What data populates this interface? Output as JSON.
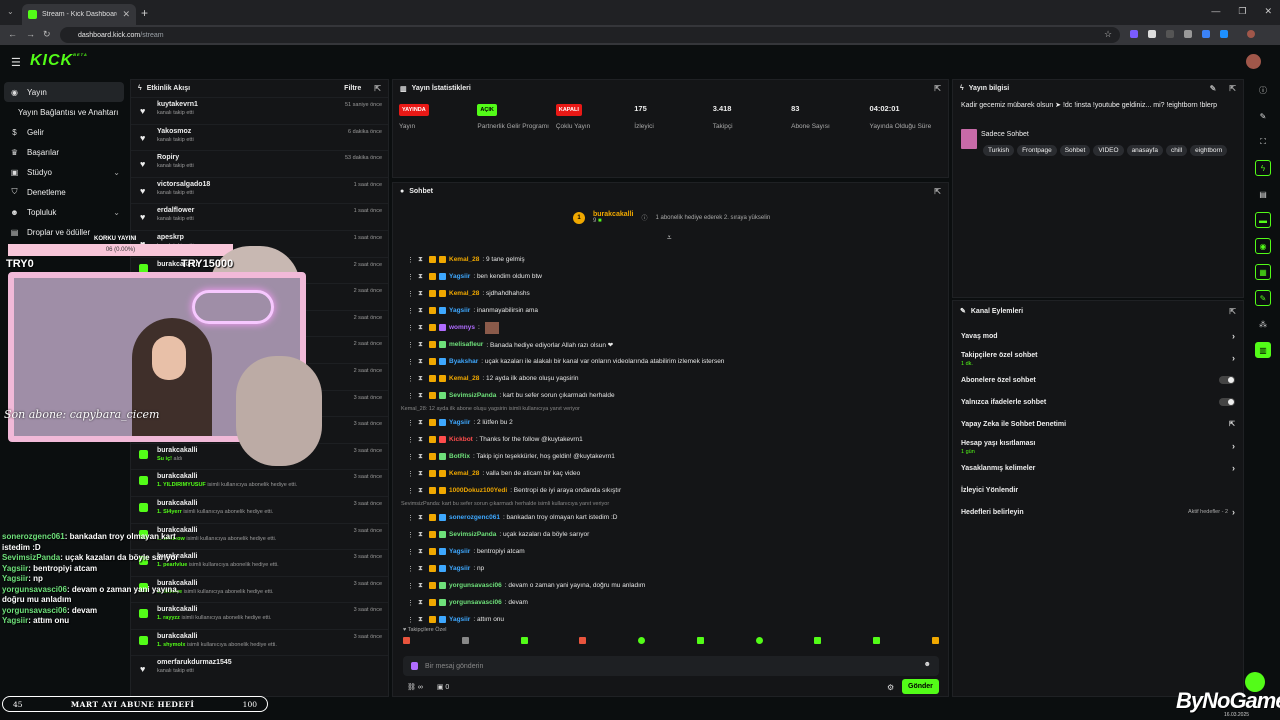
{
  "browser": {
    "tab_title": "Stream - Kick Dashboard",
    "url_host": "dashboard.kick.com",
    "url_path": "/stream"
  },
  "brand": {
    "logo": "KICK",
    "logo_sup": "BETA",
    "accent": "#53fc18"
  },
  "sidebar": {
    "items": [
      {
        "label": "Yayın",
        "icon": "broadcast-icon"
      },
      {
        "label": "Yayın Bağlantısı ve Anahtarı",
        "icon": "key-icon"
      },
      {
        "label": "Gelir",
        "icon": "money-icon"
      },
      {
        "label": "Başarılar",
        "icon": "trophy-icon"
      },
      {
        "label": "Stüdyo",
        "icon": "studio-icon"
      },
      {
        "label": "Denetleme",
        "icon": "shield-icon"
      },
      {
        "label": "Topluluk",
        "icon": "community-icon"
      },
      {
        "label": "Droplar ve ödüller",
        "icon": "gift-icon"
      }
    ]
  },
  "activity": {
    "title": "Etkinlik Akışı",
    "filter": "Filtre",
    "rows": [
      {
        "name": "kuytakevrn1",
        "desc": "kanalı takip etti",
        "time": "51 saniye önce",
        "kind": "follow"
      },
      {
        "name": "Yakosmoz",
        "desc": "kanalı takip etti",
        "time": "6 dakika önce",
        "kind": "follow"
      },
      {
        "name": "Ropiry",
        "desc": "kanalı takip etti",
        "time": "53 dakika önce",
        "kind": "follow"
      },
      {
        "name": "victorsalgado18",
        "desc": "kanalı takip etti",
        "time": "1 saat önce",
        "kind": "follow"
      },
      {
        "name": "erdalflower",
        "desc": "kanalı takip etti",
        "time": "1 saat önce",
        "kind": "follow"
      },
      {
        "name": "apeskrp",
        "desc": "kanalı takip etti",
        "time": "1 saat önce",
        "kind": "follow"
      },
      {
        "name": "burakcakalli",
        "desc": "",
        "time": "2 saat önce",
        "kind": "gift"
      },
      {
        "name": "",
        "desc": "",
        "time": "2 saat önce",
        "kind": "gift"
      },
      {
        "name": "",
        "desc": "",
        "time": "2 saat önce",
        "kind": "gift"
      },
      {
        "name": "",
        "desc": "",
        "time": "2 saat önce",
        "kind": "gift"
      },
      {
        "name": "",
        "desc": "",
        "time": "2 saat önce",
        "kind": "gift"
      },
      {
        "name": "",
        "desc": "",
        "time": "3 saat önce",
        "kind": "gift"
      },
      {
        "name": "",
        "desc": "",
        "time": "3 saat önce",
        "kind": "gift"
      },
      {
        "name": "burakcakalli",
        "desc_b": "Su iç!",
        "desc": "aldı",
        "time": "3 saat önce",
        "kind": "gift"
      },
      {
        "name": "burakcakalli",
        "desc_b": "1. YILDIRIMYUSUF",
        "desc": "isimli kullanıcıya abonelik hediye etti.",
        "time": "3 saat önce",
        "kind": "gift"
      },
      {
        "name": "burakcakalli",
        "desc_b": "1. Sl4yerr",
        "desc": "isimli kullanıcıya abonelik hediye etti.",
        "time": "3 saat önce",
        "kind": "gift"
      },
      {
        "name": "burakcakalli",
        "desc_b": "1. whusow",
        "desc": "isimli kullanıcıya abonelik hediye etti.",
        "time": "3 saat önce",
        "kind": "gift"
      },
      {
        "name": "burakcakalli",
        "desc_b": "1. pearlvlue",
        "desc": "isimli kullanıcıya abonelik hediye etti.",
        "time": "3 saat önce",
        "kind": "gift"
      },
      {
        "name": "burakcakalli",
        "desc_b": "1. W3xlee",
        "desc": "isimli kullanıcıya abonelik hediye etti.",
        "time": "3 saat önce",
        "kind": "gift"
      },
      {
        "name": "burakcakalli",
        "desc_b": "1. rayyzz",
        "desc": "isimli kullanıcıya abonelik hediye etti.",
        "time": "3 saat önce",
        "kind": "gift"
      },
      {
        "name": "burakcakalli",
        "desc_b": "1. shymolx",
        "desc": "isimli kullanıcıya abonelik hediye etti.",
        "time": "3 saat önce",
        "kind": "gift"
      },
      {
        "name": "omerfarukdurmaz1545",
        "desc": "kanalı takip etti",
        "time": "",
        "kind": "follow"
      }
    ]
  },
  "stats": {
    "title": "Yayın İstatistikleri",
    "items": [
      {
        "value": "YAYINDA",
        "label": "Yayın",
        "badge": "#e91916"
      },
      {
        "value": "AÇIK",
        "label": "Partnerlik Gelir Programı",
        "badge": "#53fc18"
      },
      {
        "value": "KAPALI",
        "label": "Çoklu Yayın",
        "badge": "#e91916"
      },
      {
        "value": "175",
        "label": "İzleyici"
      },
      {
        "value": "3.418",
        "label": "Takipçi"
      },
      {
        "value": "83",
        "label": "Abone Sayısı"
      },
      {
        "value": "04:02:01",
        "label": "Yayında Olduğu Süre"
      }
    ]
  },
  "chat": {
    "title": "Sohbet",
    "pinned_user": "burakcakalli",
    "pinned_count": "9",
    "pinned_text": "1 abonelik hediye ederek 2. sıraya yükselin",
    "pinned_rank": "1",
    "messages": [
      {
        "user": "Kemal_28",
        "text": ": 9 tane gelmiş",
        "color": "#f0a800"
      },
      {
        "user": "Yagsiir",
        "text": ": ben kendim oldum btw",
        "color": "#3ea8ff"
      },
      {
        "user": "Kemal_28",
        "text": ": sjdhahdhahshs",
        "color": "#f0a800"
      },
      {
        "user": "Yagsiir",
        "text": ": inanmayabilirsin ama",
        "color": "#3ea8ff"
      },
      {
        "user": "womnys",
        "text": ":",
        "color": "#b06cff"
      },
      {
        "user": "melisafleur",
        "text": ": Banada hediye ediyorlar Allah razı olsun ❤",
        "color": "#6ee07a"
      },
      {
        "user": "Byakshar",
        "text": ": uçak kazaları ile alakalı bir kanal var onların videolarında atabilirim izlemek istersen",
        "color": "#3ea8ff"
      },
      {
        "user": "Kemal_28",
        "text": ": 12 ayda ilk abone oluşu yagsirin",
        "color": "#f0a800"
      },
      {
        "user": "SevimsizPanda",
        "text": ": kart bu sefer sorun çıkarmadı herhalde",
        "color": "#6ee07a"
      },
      {
        "reply": "Kemal_28: 12 ayda ilk abone oluşu yagsirin isimli kullanıcıya yanıt veriyor"
      },
      {
        "user": "Yagsiir",
        "text": ": 2 lütfen bu 2",
        "color": "#3ea8ff"
      },
      {
        "user": "Kickbot",
        "text": ": Thanks for the follow @kuytakevrn1",
        "color": "#ff4d4d"
      },
      {
        "user": "BotRix",
        "text": ": Takip için teşekkürler, hoş geldin! @kuytakevrn1",
        "color": "#6ee07a"
      },
      {
        "user": "Kemal_28",
        "text": ": valla ben de aticam bir kaç video",
        "color": "#f0a800"
      },
      {
        "user": "1000Dokuz100Yedi",
        "text": ": Bentropi de iyi araya ondanda sıkıştır",
        "color": "#f0a800"
      },
      {
        "reply": "SevimsizPanda: kart bu sefer sorun çıkarmadı herhalde isimli kullanıcıya yanıt veriyor"
      },
      {
        "user": "sonerozgenc061",
        "text": ": bankadan troy olmayan kart istedim :D",
        "color": "#3ea8ff"
      },
      {
        "user": "SevimsizPanda",
        "text": ": uçak kazaları da böyle sarıyor",
        "color": "#6ee07a"
      },
      {
        "user": "Yagsiir",
        "text": ": bentropiyi atcam",
        "color": "#3ea8ff"
      },
      {
        "user": "Yagsiir",
        "text": ": np",
        "color": "#3ea8ff"
      },
      {
        "user": "yorgunsavasci06",
        "text": ": devam o zaman yani yayına, doğru mu anladım",
        "color": "#6ee07a"
      },
      {
        "user": "yorgunsavasci06",
        "text": ": devam",
        "color": "#6ee07a"
      },
      {
        "user": "Yagsiir",
        "text": ": attım onu",
        "color": "#3ea8ff"
      }
    ],
    "followers_only_label": "Takipçilere Özel",
    "input_placeholder": "Bir mesaj gönderin",
    "points": "0",
    "send_label": "Gönder"
  },
  "stream_info": {
    "title": "Yayın bilgisi",
    "stream_title": "Kadir gecemiz mübarek olsun ➤ !dc !insta !youtube geldiniz... mi? !eightborn !blerp",
    "category": "Sadece Sohbet",
    "tags": [
      "Turkish",
      "Frontpage",
      "Sohbet",
      "VIDEO",
      "anasayfa",
      "chill",
      "eightborn"
    ]
  },
  "channel_actions": {
    "title": "Kanal Eylemleri",
    "rows": [
      {
        "label": "Yavaş mod",
        "type": "arrow"
      },
      {
        "label": "Takipçilere özel sohbet",
        "sub": "1 dk.",
        "type": "arrow"
      },
      {
        "label": "Abonelere özel sohbet",
        "type": "toggle"
      },
      {
        "label": "Yalnızca ifadelerle sohbet",
        "type": "toggle"
      },
      {
        "label": "Yapay Zeka ile Sohbet Denetimi",
        "type": "external"
      },
      {
        "label": "Hesap yaşı kısıtlaması",
        "sub": "1 gün",
        "type": "arrow"
      },
      {
        "label": "Yasaklanmış kelimeler",
        "type": "arrow"
      },
      {
        "label": "İzleyici Yönlendir",
        "type": "none"
      },
      {
        "label": "Hedefleri belirleyin",
        "extra": "Aktif hedefler - 2",
        "type": "arrow"
      }
    ]
  },
  "overlay": {
    "korku_label": "KORKU YAYINI",
    "korku_progress": "06 (0.00%)",
    "try_left": "TRY0",
    "try_right": "TRY15000",
    "last_sub": "Son abone: capybara_cicem",
    "chat": [
      {
        "user": "sonerozgenc061",
        "text": ": bankadan troy olmayan kart istedim :D"
      },
      {
        "user": "SevimsizPanda",
        "text": ": uçak kazaları da böyle sarıyor"
      },
      {
        "user": "Yagsiir",
        "text": ": bentropiyi atcam"
      },
      {
        "user": "Yagsiir",
        "text": ": np"
      },
      {
        "user": "yorgunsavasci06",
        "text": ": devam o zaman yani yayına, doğru mu anladım"
      },
      {
        "user": "yorgunsavasci06",
        "text": ": devam"
      },
      {
        "user": "Yagsiir",
        "text": ": attım onu"
      }
    ],
    "goal_left": "45",
    "goal_label": "MART AYI ABUNE HEDEFİ",
    "goal_right": "100",
    "watermark": "ByNoGame",
    "watermark_date": "16.03.2025"
  }
}
